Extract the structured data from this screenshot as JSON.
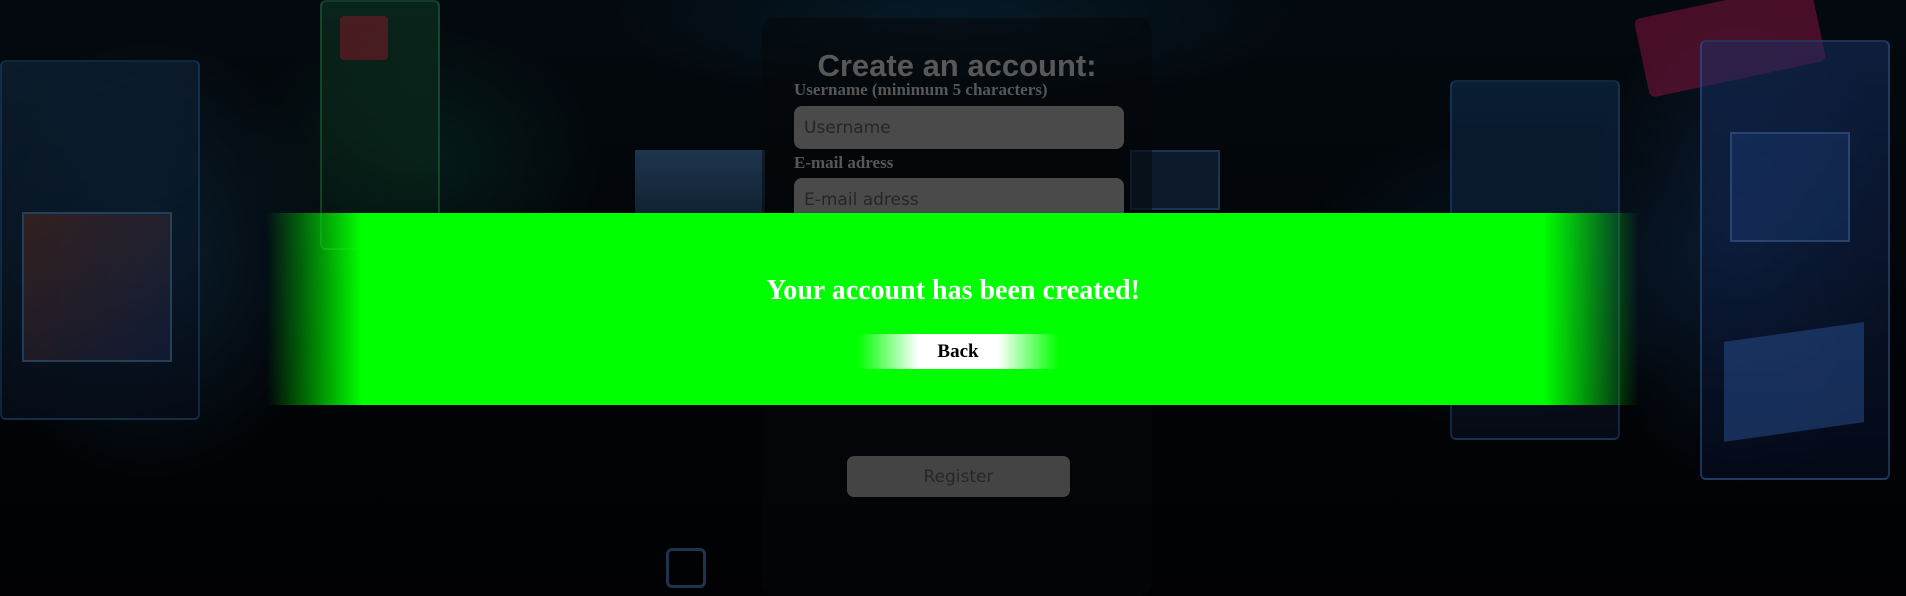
{
  "form": {
    "title": "Create an account:",
    "username_label": "Username (minimum 5 characters)",
    "username_placeholder": "Username",
    "username_value": "",
    "email_label": "E-mail adress",
    "email_placeholder": "E-mail adress",
    "email_value": "",
    "register_label": "Register"
  },
  "success": {
    "message": "Your account has been created!",
    "back_label": "Back"
  },
  "colors": {
    "banner": "#00ff00",
    "input": "#787878",
    "button": "#6f6f6f"
  }
}
